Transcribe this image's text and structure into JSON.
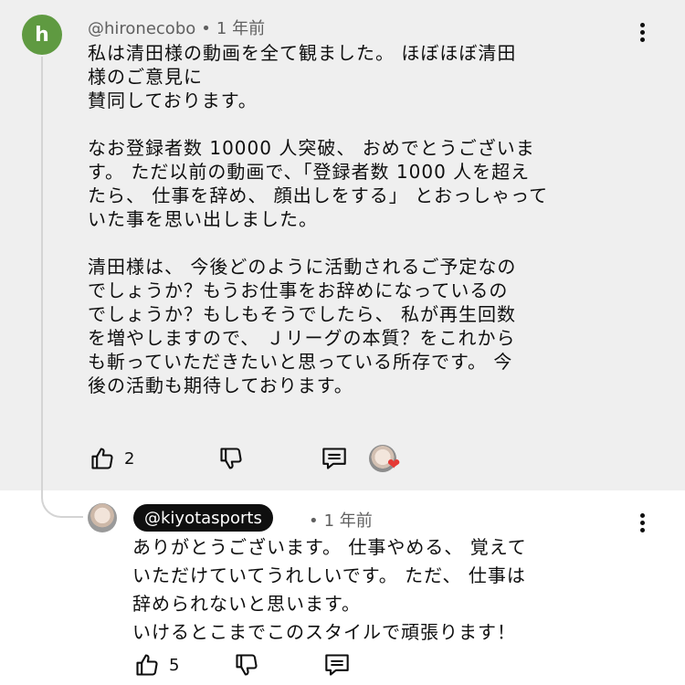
{
  "comment": {
    "avatar_letter": "h",
    "avatar_color": "#5f9a41",
    "author": "@hironecobo",
    "time": "1 年前",
    "text": "私は清田様の動画を全て観ました。 ほぼほぼ清田\n様のご意見に\n賛同しております。\n\nなお登録者数 10000 人突破、 おめでとうございま\nす。 ただ以前の動画で、「登録者数 1000 人を超え\nたら、 仕事を辞め、 顔出しをする」 とおっしゃって\nいた事を思い出しました。\n\n清田様は、 今後どのように活動されるご予定なの\nでしょうか？もうお仕事をお辞めになっているの\nでしょうか？もしもそうでしたら、 私が再生回数\nを増やしますので、 Ｊリーグの本質？をこれから\nも斬っていただきたいと思っている所存です。 今\n後の活動も期待しております。",
    "like_count": "2",
    "creator_heart": true
  },
  "reply": {
    "author": "@kiyotasports",
    "time": "1 年前",
    "text": "ありがとうございます。 仕事やめる、 覚えて\nいただけていてうれしいです。 ただ、 仕事は\n辞められないと思います。\nいけるとこまでこのスタイルで頑張ります！",
    "like_count": "5"
  },
  "icons": [
    "thumbs-up-icon",
    "thumbs-down-icon",
    "reply-comment-icon",
    "more-vertical-icon",
    "heart-icon"
  ],
  "colors": {
    "background_highlight": "#efefef",
    "heart": "#e53935",
    "meta_text": "#606060"
  }
}
